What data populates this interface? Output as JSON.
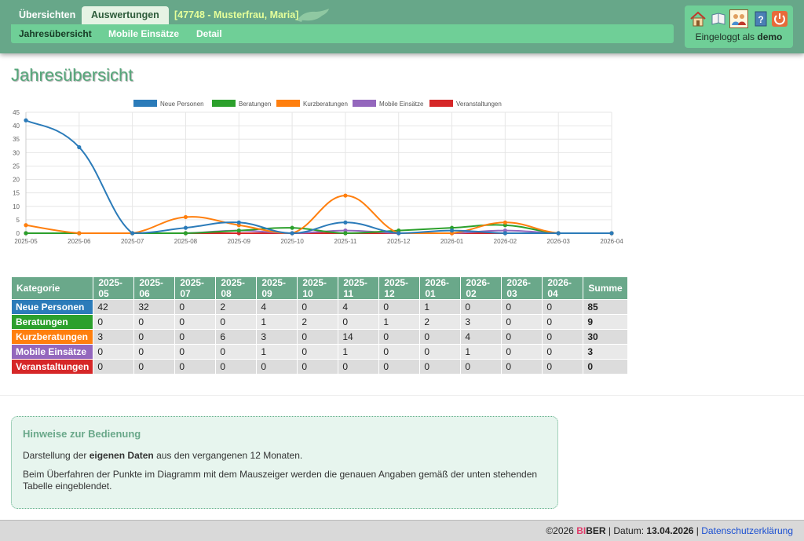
{
  "header": {
    "tabs": [
      {
        "label": "Übersichten"
      },
      {
        "label": "Auswertungen"
      }
    ],
    "client": "[47748 - Musterfrau, Maria]",
    "subnav": [
      {
        "label": "Jahresübersicht"
      },
      {
        "label": "Mobile Einsätze"
      },
      {
        "label": "Detail"
      }
    ],
    "user_icons": [
      "home-icon",
      "book-icon",
      "users-icon",
      "help-icon",
      "power-icon"
    ],
    "login_prefix": "Eingeloggt als",
    "login_user": "demo"
  },
  "page_title": "Jahresübersicht",
  "chart_data": {
    "type": "line",
    "categories": [
      "2025-05",
      "2025-06",
      "2025-07",
      "2025-08",
      "2025-09",
      "2025-10",
      "2025-11",
      "2025-12",
      "2026-01",
      "2026-02",
      "2026-03",
      "2026-04"
    ],
    "ylim": [
      0,
      45
    ],
    "yticks": [
      0,
      5,
      10,
      15,
      20,
      25,
      30,
      35,
      40,
      45
    ],
    "legend": "top",
    "grid": true,
    "series": [
      {
        "name": "Neue Personen",
        "color": "#2b7bb9",
        "values": [
          42,
          32,
          0,
          2,
          4,
          0,
          4,
          0,
          1,
          0,
          0,
          0
        ]
      },
      {
        "name": "Beratungen",
        "color": "#2ca02c",
        "values": [
          0,
          0,
          0,
          0,
          1,
          2,
          0,
          1,
          2,
          3,
          0,
          0
        ]
      },
      {
        "name": "Kurzberatungen",
        "color": "#ff7f0e",
        "values": [
          3,
          0,
          0,
          6,
          3,
          0,
          14,
          0,
          0,
          4,
          0,
          0
        ]
      },
      {
        "name": "Mobile Einsätze",
        "color": "#9467bd",
        "values": [
          0,
          0,
          0,
          0,
          1,
          0,
          1,
          0,
          0,
          1,
          0,
          0
        ]
      },
      {
        "name": "Veranstaltungen",
        "color": "#d62728",
        "values": [
          0,
          0,
          0,
          0,
          0,
          0,
          0,
          0,
          0,
          0,
          0,
          0
        ]
      }
    ]
  },
  "table": {
    "headers": [
      "Kategorie",
      "2025-05",
      "2025-06",
      "2025-07",
      "2025-08",
      "2025-09",
      "2025-10",
      "2025-11",
      "2025-12",
      "2026-01",
      "2026-02",
      "2026-03",
      "2026-04",
      "Summe"
    ],
    "rows": [
      {
        "label": "Neue Personen",
        "color": "#2b7bb9",
        "values": [
          "42",
          "32",
          "0",
          "2",
          "4",
          "0",
          "4",
          "0",
          "1",
          "0",
          "0",
          "0"
        ],
        "sum": "85"
      },
      {
        "label": "Beratungen",
        "color": "#2ca02c",
        "values": [
          "0",
          "0",
          "0",
          "0",
          "1",
          "2",
          "0",
          "1",
          "2",
          "3",
          "0",
          "0"
        ],
        "sum": "9"
      },
      {
        "label": "Kurzberatungen",
        "color": "#ff7f0e",
        "values": [
          "3",
          "0",
          "0",
          "6",
          "3",
          "0",
          "14",
          "0",
          "0",
          "4",
          "0",
          "0"
        ],
        "sum": "30"
      },
      {
        "label": "Mobile Einsätze",
        "color": "#9467bd",
        "values": [
          "0",
          "0",
          "0",
          "0",
          "1",
          "0",
          "1",
          "0",
          "0",
          "1",
          "0",
          "0"
        ],
        "sum": "3"
      },
      {
        "label": "Veranstaltungen",
        "color": "#d62728",
        "values": [
          "0",
          "0",
          "0",
          "0",
          "0",
          "0",
          "0",
          "0",
          "0",
          "0",
          "0",
          "0"
        ],
        "sum": "0"
      }
    ]
  },
  "help": {
    "title": "Hinweise zur Bedienung",
    "p1_pre": "Darstellung der ",
    "p1_bold": "eigenen Daten",
    "p1_post": " aus den vergangenen 12 Monaten.",
    "p2": "Beim Überfahren der Punkte im Diagramm mit dem Mauszeiger werden die genauen Angaben gemäß der unten stehenden Tabelle eingeblendet."
  },
  "footer": {
    "copyright": "©2026",
    "brand_a": "BI",
    "brand_b": "BER",
    "sep1": "|",
    "date_label": "Datum:",
    "date": "13.04.2026",
    "sep2": "|",
    "privacy": "Datenschutzerklärung"
  }
}
